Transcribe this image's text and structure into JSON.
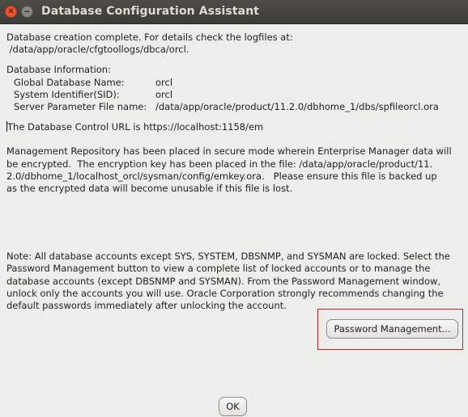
{
  "window": {
    "title": "Database Configuration Assistant",
    "close_glyph": "✕",
    "minimize_glyph": "‒"
  },
  "message": {
    "creation_line1": "Database creation complete. For details check the logfiles at:",
    "creation_line2": " /data/app/oracle/cfgtoollogs/dbca/orcl.",
    "info_heading": "Database Information:",
    "global_db_name_label": "Global Database Name:",
    "global_db_name_value": "orcl",
    "sid_label": "System Identifier(SID):",
    "sid_value": "orcl",
    "spfile_label": "Server Parameter File name:",
    "spfile_value": "/data/app/oracle/product/11.2.0/dbhome_1/dbs/spfileorcl.ora",
    "control_url": "The Database Control URL is https://localhost:1158/em",
    "repo_lines": [
      "Management Repository has been placed in secure mode wherein Enterprise Manager data will",
      "be encrypted.  The encryption key has been placed in the file: /data/app/oracle/product/11.",
      "2.0/dbhome_1/localhost_orcl/sysman/config/emkey.ora.   Please ensure this file is backed up",
      "as the encrypted data will become unusable if this file is lost."
    ],
    "note_lines": [
      "Note: All database accounts except SYS, SYSTEM, DBSNMP, and SYSMAN are locked. Select the",
      "Password Management button to view a complete list of locked accounts or to manage the",
      "database accounts (except DBSNMP and SYSMAN). From the Password Management window,",
      "unlock only the accounts you will use. Oracle Corporation strongly recommends changing the",
      "default passwords immediately after unlocking the account."
    ]
  },
  "buttons": {
    "password_management": "Password Management...",
    "ok": "OK"
  },
  "colors": {
    "highlight_box": "#c9262b",
    "title_bar": "#3c3b37",
    "background": "#ededeb"
  }
}
